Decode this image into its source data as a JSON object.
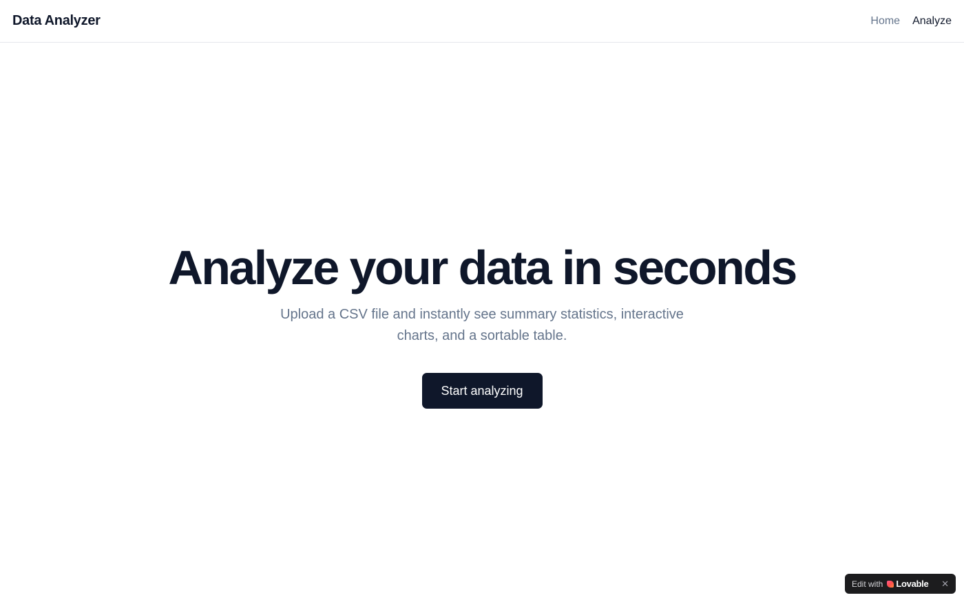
{
  "header": {
    "brand": "Data Analyzer",
    "nav": {
      "home": "Home",
      "analyze": "Analyze"
    }
  },
  "hero": {
    "title": "Analyze your data in seconds",
    "subtitle": "Upload a CSV file and instantly see summary statistics, interactive charts, and a sortable table.",
    "cta_label": "Start analyzing"
  },
  "badge": {
    "edit_text": "Edit with",
    "brand": "Lovable",
    "logo_icon": "lovable-heart-icon",
    "close_icon": "close-icon",
    "close_glyph": "✕"
  },
  "colors": {
    "primary": "#0f172a",
    "muted_text": "#64748b",
    "border": "#e5e7eb",
    "badge_bg": "#1c1c1e"
  }
}
